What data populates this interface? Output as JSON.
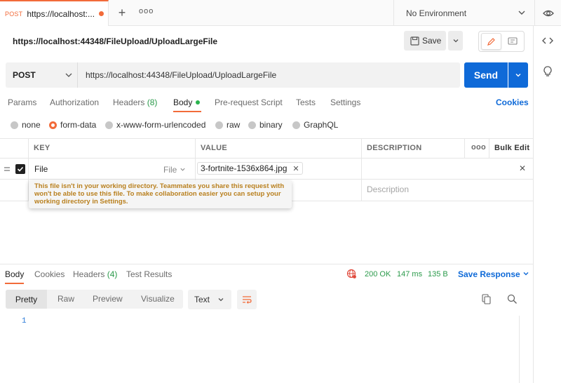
{
  "tabs": {
    "active": {
      "method": "POST",
      "title": "https://localhost:..."
    },
    "more_label": "ooo"
  },
  "environment": {
    "selected": "No Environment"
  },
  "header": {
    "url_text": "https://localhost:44348/FileUpload/UploadLargeFile",
    "save_label": "Save"
  },
  "request": {
    "method": "POST",
    "url": "https://localhost:44348/FileUpload/UploadLargeFile",
    "send_label": "Send",
    "tabs": {
      "params": "Params",
      "authorization": "Authorization",
      "headers": "Headers",
      "headers_count": "(8)",
      "body": "Body",
      "pre_request": "Pre-request Script",
      "tests": "Tests",
      "settings": "Settings"
    },
    "cookies_label": "Cookies",
    "body_types": [
      "none",
      "form-data",
      "x-www-form-urlencoded",
      "raw",
      "binary",
      "GraphQL"
    ],
    "body_type_selected": "form-data"
  },
  "form_table": {
    "columns": {
      "key": "KEY",
      "value": "VALUE",
      "description": "DESCRIPTION",
      "more": "ooo",
      "bulk_edit": "Bulk Edit"
    },
    "rows": [
      {
        "key": "File",
        "type": "File",
        "value": "3-fortnite-1536x864.jpg",
        "description": ""
      }
    ],
    "new_row_description_placeholder": "Description"
  },
  "warning_tooltip": {
    "text": "This file isn't in your working directory. Teammates you share this request with won't be able to use this file. To make collaboration easier you can setup your working directory in Settings."
  },
  "response": {
    "tabs": {
      "body": "Body",
      "cookies": "Cookies",
      "headers": "Headers",
      "headers_count": "(4)",
      "test_results": "Test Results"
    },
    "status": "200 OK",
    "time": "147 ms",
    "size": "135 B",
    "save_label": "Save Response",
    "views": [
      "Pretty",
      "Raw",
      "Preview",
      "Visualize"
    ],
    "view_selected": "Pretty",
    "format": "Text",
    "line_numbers": [
      "1"
    ]
  },
  "colors": {
    "accent": "#f26b3a",
    "primary": "#0f6ad8",
    "success": "#2b9a4b",
    "warning_text": "#b9801f"
  }
}
